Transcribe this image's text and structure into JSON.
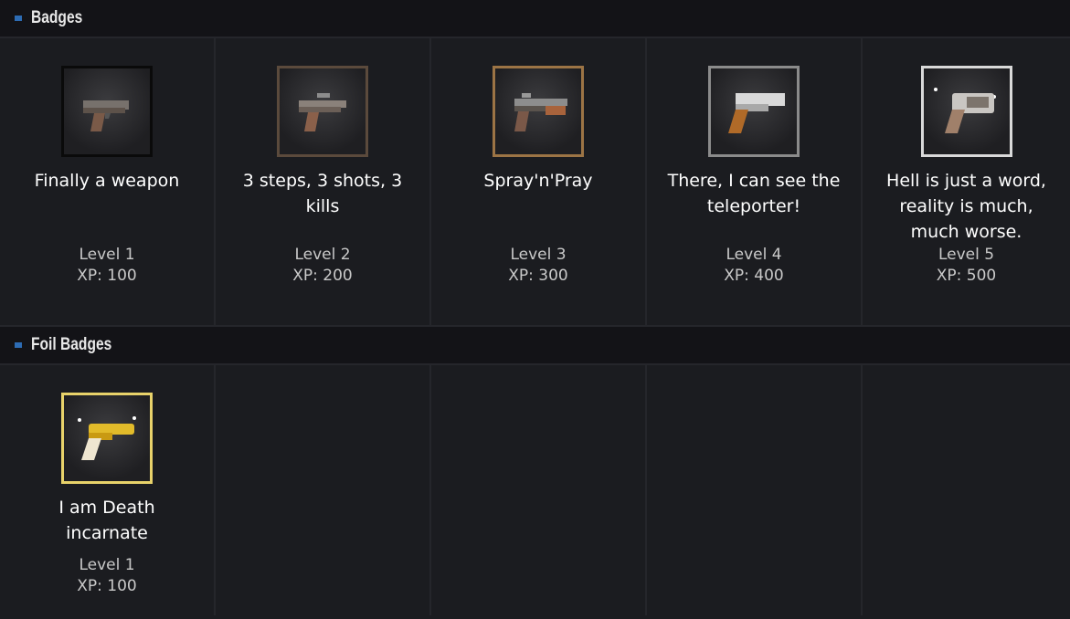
{
  "sections": [
    {
      "title": "Badges",
      "badges": [
        {
          "name": "Finally a weapon",
          "level": "Level 1",
          "xp": "XP: 100",
          "frame_color": "#0a0a0a",
          "icon": "pistol-icon"
        },
        {
          "name": "3 steps, 3 shots, 3 kills",
          "level": "Level 2",
          "xp": "XP: 200",
          "frame_color": "#5b4a3c",
          "icon": "pistol-scope-icon"
        },
        {
          "name": "Spray'n'Pray",
          "level": "Level 3",
          "xp": "XP: 300",
          "frame_color": "#9c7445",
          "icon": "pistol-mod-icon"
        },
        {
          "name": "There, I can see the teleporter!",
          "level": "Level 4",
          "xp": "XP: 400",
          "frame_color": "#8b8b8b",
          "icon": "heavy-pistol-icon"
        },
        {
          "name": "Hell is just a word, reality is much, much worse.",
          "level": "Level 5",
          "xp": "XP: 500",
          "frame_color": "#d9d9d9",
          "icon": "revolver-icon"
        }
      ]
    },
    {
      "title": "Foil Badges",
      "badges": [
        {
          "name": "I am Death incarnate",
          "level": "Level 1",
          "xp": "XP: 100",
          "frame_color": "#e8d26a",
          "icon": "golden-revolver-icon"
        }
      ]
    }
  ],
  "colors": {
    "accent": "#2d6cb4",
    "background": "#1b1c20",
    "header": "#131317"
  }
}
